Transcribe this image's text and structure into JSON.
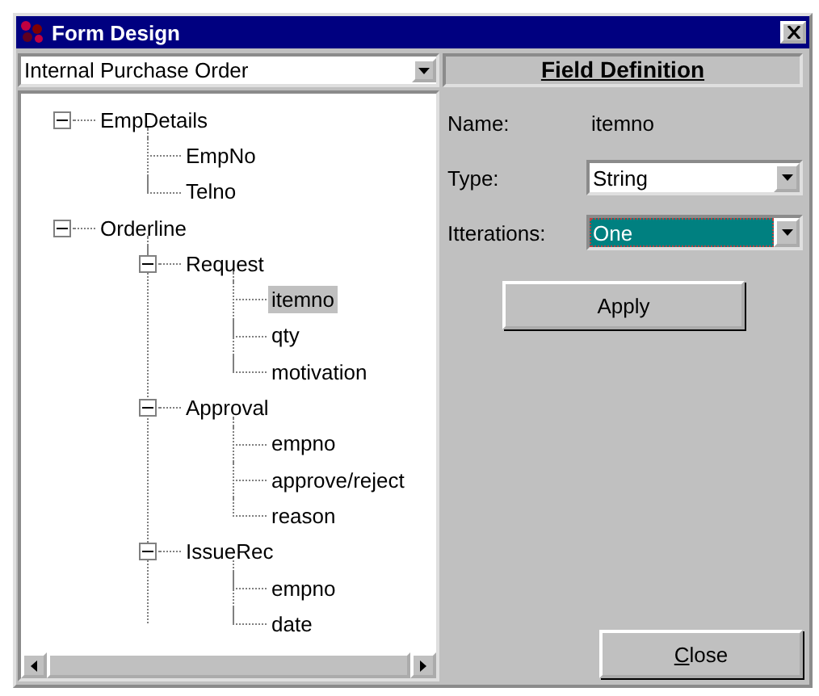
{
  "window": {
    "title": "Form Design"
  },
  "form_selector": {
    "value": "Internal Purchase Order"
  },
  "tree": [
    {
      "label": "EmpDetails",
      "expanded": true,
      "selected": false,
      "children": [
        {
          "label": "EmpNo",
          "selected": false
        },
        {
          "label": "Telno",
          "selected": false
        }
      ]
    },
    {
      "label": "Orderline",
      "expanded": true,
      "selected": false,
      "children": [
        {
          "label": "Request",
          "expanded": true,
          "selected": false,
          "children": [
            {
              "label": "itemno",
              "selected": true
            },
            {
              "label": "qty",
              "selected": false
            },
            {
              "label": "motivation",
              "selected": false
            }
          ]
        },
        {
          "label": "Approval",
          "expanded": true,
          "selected": false,
          "children": [
            {
              "label": "empno",
              "selected": false
            },
            {
              "label": "approve/reject",
              "selected": false
            },
            {
              "label": "reason",
              "selected": false
            }
          ]
        },
        {
          "label": "IssueRec",
          "expanded": true,
          "selected": false,
          "children": [
            {
              "label": "empno",
              "selected": false
            },
            {
              "label": "date",
              "selected": false
            }
          ]
        }
      ]
    }
  ],
  "panel": {
    "title": "Field Definition",
    "name_label": "Name:",
    "name_value": "itemno",
    "fields": [
      {
        "label": "Type:",
        "value": "String",
        "focused": false
      },
      {
        "label": "Itterations:",
        "value": "One",
        "focused": true
      }
    ],
    "apply_button": "Apply"
  },
  "close_button": "Close"
}
